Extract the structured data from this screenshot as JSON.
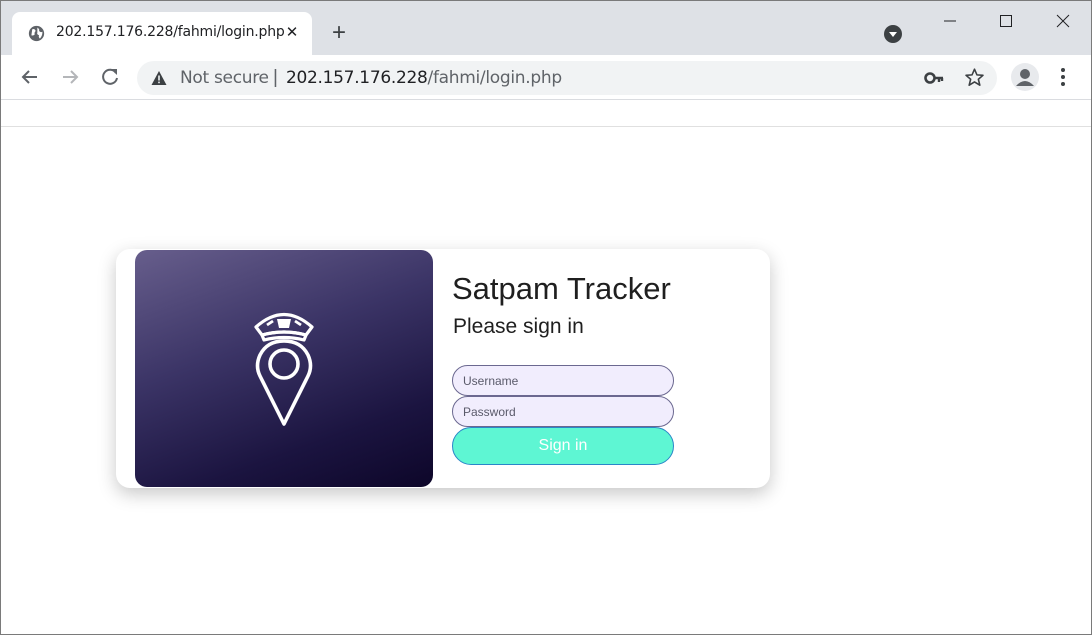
{
  "browser": {
    "tab_title": "202.157.176.228/fahmi/login.php",
    "security_label": "Not secure",
    "separator": "|",
    "url_host": "202.157.176.228",
    "url_path": "/fahmi/login.php"
  },
  "icons": {
    "favicon": "globe-icon",
    "tab_close": "close-icon",
    "new_tab": "plus-icon",
    "tab_search": "chevron-down-circle-icon",
    "minimize": "minimize-icon",
    "maximize": "maximize-icon",
    "close": "close-icon",
    "back": "arrow-left-icon",
    "forward": "arrow-right-icon",
    "reload": "reload-icon",
    "warning": "warning-icon",
    "key": "key-icon",
    "star": "star-icon",
    "profile": "person-icon",
    "menu": "kebab-menu-icon",
    "logo": "police-cap-location-pin-icon"
  },
  "login": {
    "title": "Satpam Tracker",
    "subtitle": "Please sign in",
    "username_placeholder": "Username",
    "password_placeholder": "Password",
    "submit_label": "Sign in"
  },
  "colors": {
    "button_bg": "#5ef6d3",
    "input_bg": "#f1edfd",
    "hero_gradient_top": "#675e8c",
    "hero_gradient_bottom": "#0d0629"
  }
}
